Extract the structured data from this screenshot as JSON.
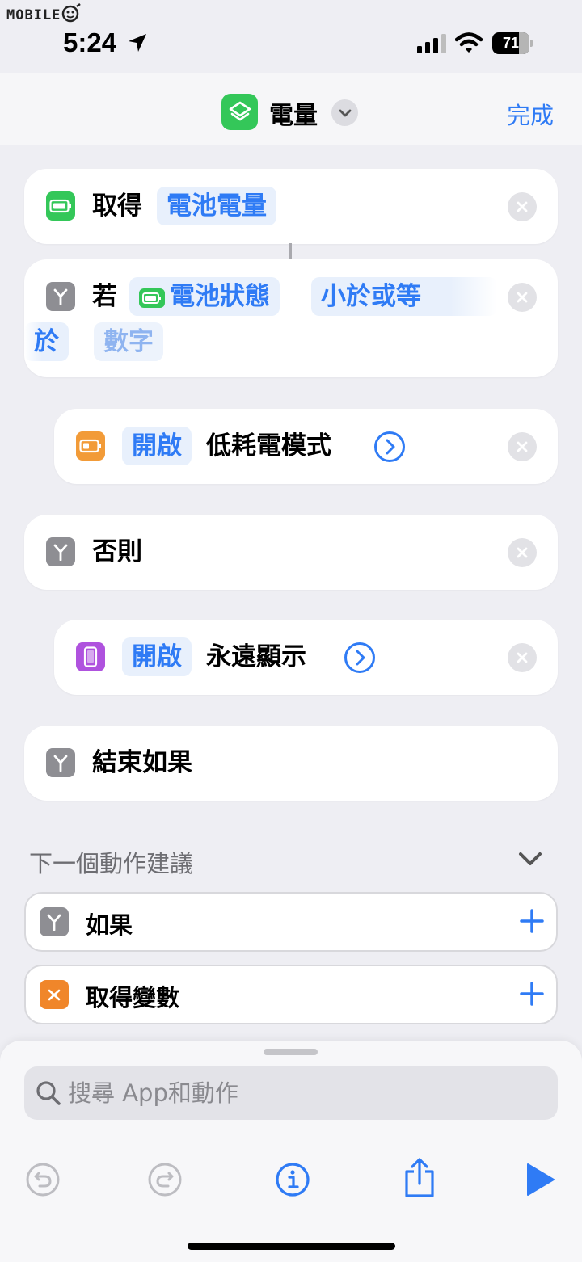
{
  "watermark": "MOBILE",
  "status": {
    "time": "5:24",
    "battery_percent": "71",
    "battery_level": 0.71
  },
  "nav": {
    "title": "電量",
    "done_label": "完成"
  },
  "actions": {
    "get": {
      "verb": "取得",
      "param": "電池電量"
    },
    "if": {
      "verb": "若",
      "param": "電池狀態",
      "condition_line1": "小於或等",
      "condition_line2": "於",
      "value_placeholder": "數字"
    },
    "low_power": {
      "chip": "開啟",
      "label": "低耗電模式"
    },
    "otherwise": {
      "label": "否則"
    },
    "always_on": {
      "chip": "開啟",
      "label": "永遠顯示"
    },
    "end_if": {
      "label": "結束如果"
    }
  },
  "suggestions": {
    "title": "下一個動作建議",
    "items": [
      {
        "label": "如果"
      },
      {
        "label": "取得變數"
      }
    ]
  },
  "search": {
    "placeholder": "搜尋 App和動作"
  },
  "colors": {
    "accent": "#2f7bf5",
    "green": "#34c759",
    "grey": "#8e8e93",
    "orange": "#f29b38",
    "purple": "#af52de"
  },
  "icons": [
    "location-arrow-icon",
    "cellular-signal-icon",
    "wifi-icon",
    "battery-icon",
    "layers-icon",
    "chevron-down-icon",
    "branch-icon",
    "battery-action-icon",
    "iphone-icon",
    "close-icon",
    "chevron-right-icon",
    "plus-icon",
    "variable-icon",
    "search-icon",
    "undo-icon",
    "redo-icon",
    "info-icon",
    "share-icon",
    "play-icon"
  ]
}
